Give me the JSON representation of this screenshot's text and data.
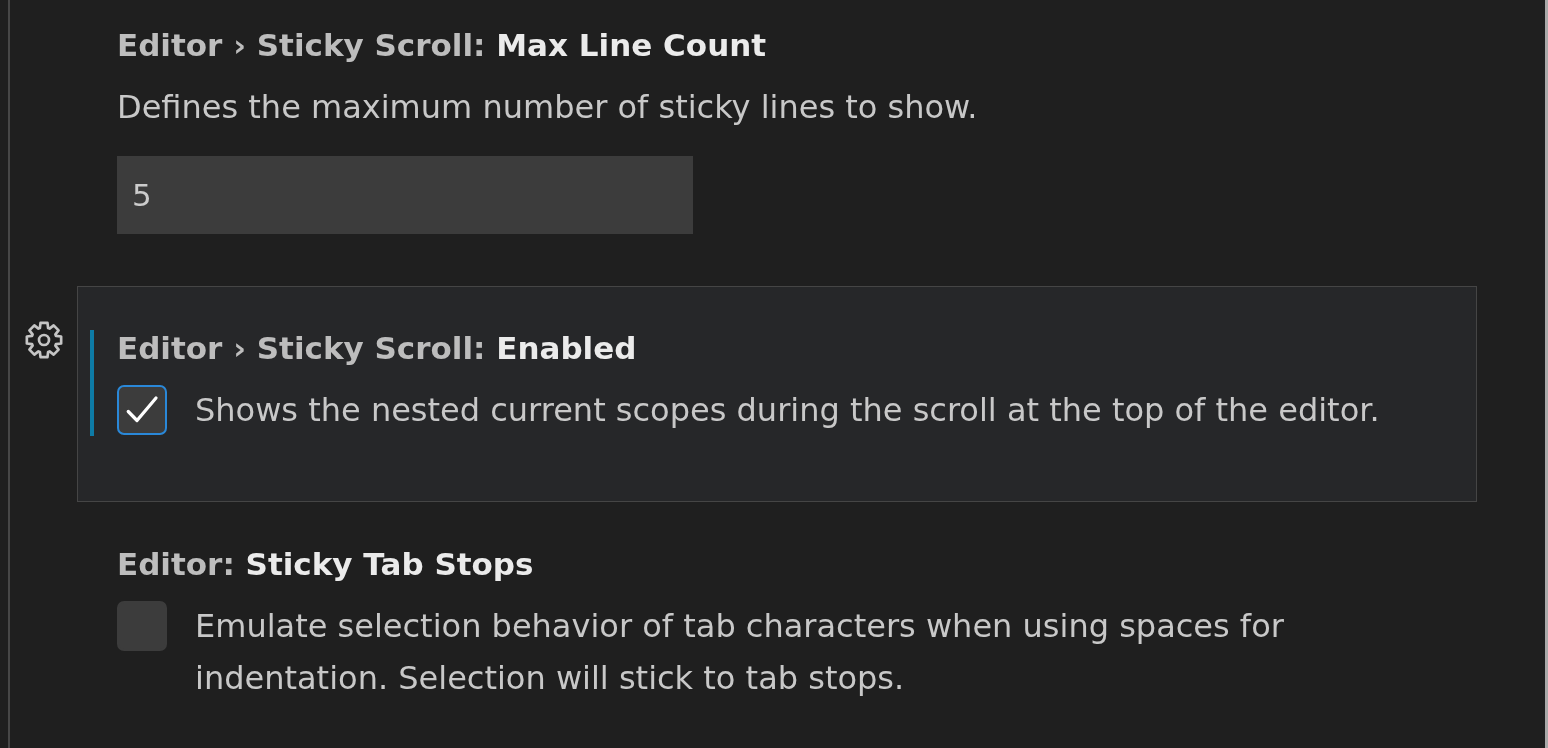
{
  "settings": [
    {
      "kind": "number",
      "focused": false,
      "category": "Editor › Sticky Scroll:",
      "label": "Max Line Count",
      "description": "Defines the maximum number of sticky lines to show.",
      "value": "5"
    },
    {
      "kind": "checkbox",
      "focused": true,
      "category": "Editor › Sticky Scroll:",
      "label": "Enabled",
      "checked": true,
      "description": "Shows the nested current scopes during the scroll at the top of the editor."
    },
    {
      "kind": "checkbox",
      "focused": false,
      "category": "Editor:",
      "label": "Sticky Tab Stops",
      "checked": false,
      "description": "Emulate selection behavior of tab characters when using spaces for indentation. Selection will stick to tab stops."
    }
  ]
}
